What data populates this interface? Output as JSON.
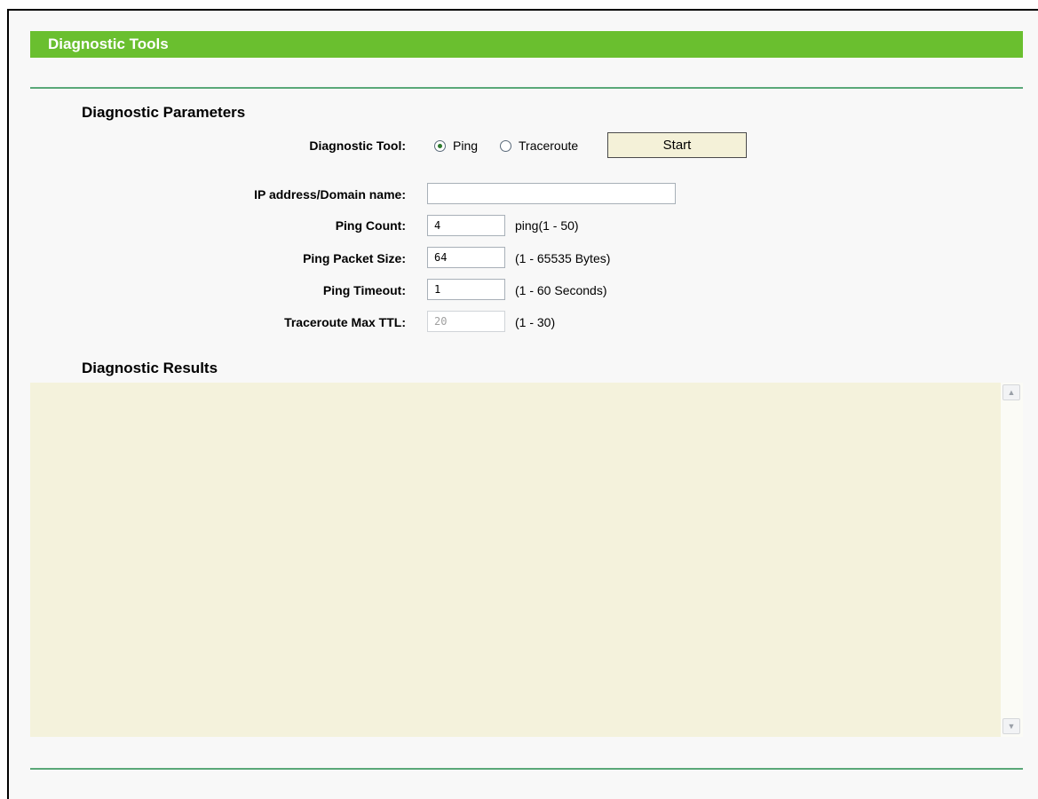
{
  "header": {
    "title": "Diagnostic Tools"
  },
  "parameters": {
    "heading": "Diagnostic Parameters",
    "tool_label": "Diagnostic Tool:",
    "tool_options": [
      {
        "label": "Ping",
        "selected": true
      },
      {
        "label": "Traceroute",
        "selected": false
      }
    ],
    "start_label": "Start",
    "ip_label": "IP address/Domain name:",
    "ip_value": "",
    "ping_count_label": "Ping Count:",
    "ping_count_value": "4",
    "ping_count_hint": "ping(1 - 50)",
    "packet_size_label": "Ping Packet Size:",
    "packet_size_value": "64",
    "packet_size_hint": "(1 - 65535 Bytes)",
    "timeout_label": "Ping Timeout:",
    "timeout_value": "1",
    "timeout_hint": "(1 - 60 Seconds)",
    "max_ttl_label": "Traceroute Max TTL:",
    "max_ttl_value": "20",
    "max_ttl_hint": "(1 - 30)"
  },
  "results": {
    "heading": "Diagnostic Results",
    "content": ""
  },
  "colors": {
    "title_bar": "#6abf2f",
    "rule": "#5aa878",
    "results_background": "#f4f2dc",
    "button_background": "#f4f1d8"
  },
  "icons": {
    "scroll_up": "scroll-up-arrow-icon",
    "scroll_down": "scroll-down-arrow-icon"
  }
}
